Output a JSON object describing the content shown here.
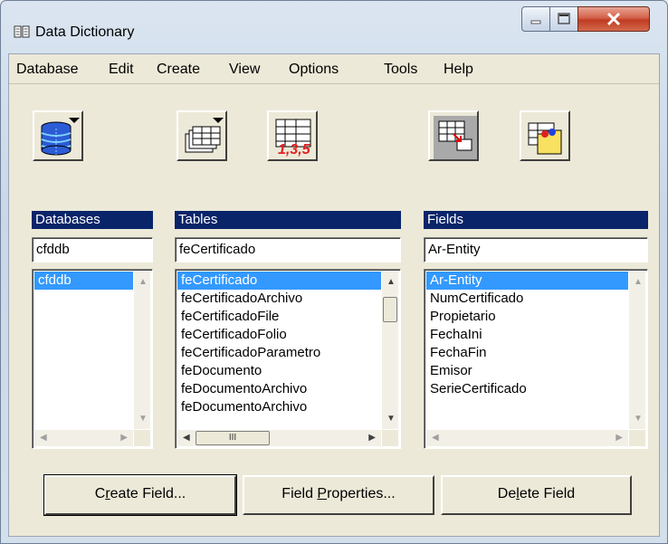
{
  "window": {
    "title": "Data Dictionary",
    "icon": "book-icon",
    "controls": {
      "minimize": "minimize-icon",
      "maximize": "maximize-icon",
      "close": "close-icon"
    }
  },
  "menu": [
    "Database",
    "Edit",
    "Create",
    "View",
    "Options",
    "Tools",
    "Help"
  ],
  "toolbar": {
    "icons": [
      "database-stack-icon",
      "table-dropdown-icon",
      "table-numbered-icon",
      "table-export-icon",
      "folders-icon"
    ]
  },
  "databases": {
    "header": "Databases",
    "value": "cfddb",
    "items": [
      "cfddb"
    ],
    "selected": 0
  },
  "tables": {
    "header": "Tables",
    "value": "feCertificado",
    "items": [
      "feCertificado",
      "feCertificadoArchivo",
      "feCertificadoFile",
      "feCertificadoFolio",
      "feCertificadoParametro",
      "feDocumento",
      "feDocumentoArchivo",
      "feDocumentoArchivo"
    ],
    "selected": 0,
    "hscroll_thumb": "III"
  },
  "fields": {
    "header": "Fields",
    "value": "Ar-Entity",
    "items": [
      "Ar-Entity",
      "NumCertificado",
      "Propietario",
      "FechaIni",
      "FechaFin",
      "Emisor",
      "SerieCertificado"
    ],
    "selected": 0
  },
  "buttons": {
    "create_field": {
      "pre": "C",
      "acc": "r",
      "post": "eate Field..."
    },
    "field_properties": {
      "pre": "Field ",
      "acc": "P",
      "post": "roperties..."
    },
    "delete_field": {
      "pre": "De",
      "acc": "l",
      "post": "ete Field"
    }
  },
  "colors": {
    "header_bg": "#0a246a",
    "selection": "#3399ff",
    "dialog_bg": "#ece9d8"
  }
}
